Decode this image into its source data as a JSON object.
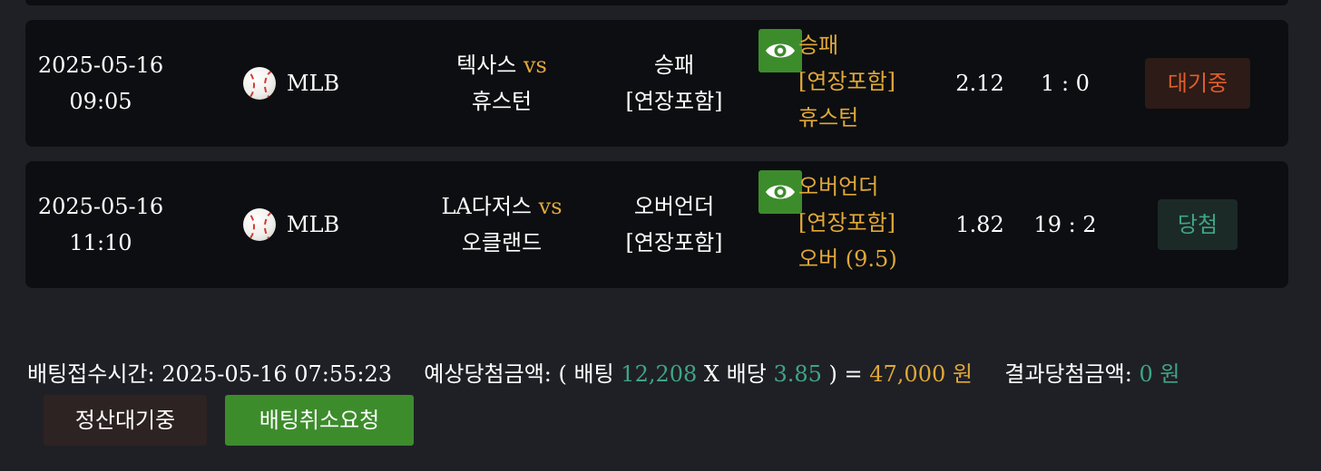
{
  "bets": [
    {
      "date": "2025-05-16",
      "time": "09:05",
      "league": "MLB",
      "league_icon": "baseball-icon",
      "home_team": "텍사스",
      "vs": "vs",
      "away_team": "휴스턴",
      "market_line1": "승패",
      "market_line2": "[연장포함]",
      "pick_line1": "승패",
      "pick_line2": "[연장포함]",
      "pick_line3": "휴스턴",
      "odds": "2.12",
      "score": "1 : 0",
      "status": "대기중",
      "status_color": "#e05d2b"
    },
    {
      "date": "2025-05-16",
      "time": "11:10",
      "league": "MLB",
      "league_icon": "baseball-icon",
      "home_team": "LA다저스",
      "vs": "vs",
      "away_team": "오클랜드",
      "market_line1": "오버언더",
      "market_line2": "[연장포함]",
      "pick_line1": "오버언더",
      "pick_line2": "[연장포함]",
      "pick_line3": "오버 (9.5)",
      "odds": "1.82",
      "score": "19 : 2",
      "status": "당첨",
      "status_color": "#3fa585"
    }
  ],
  "summary": {
    "bet_time_label": "배팅접수시간:",
    "bet_time": "2025-05-16 07:55:23",
    "expected_label": "예상당첨금액: ( 배팅",
    "bet_amount": "12,208",
    "x_label": "X 배당",
    "total_odds": "3.85",
    "equals": ") =",
    "expected_amount": "47,000 원",
    "result_label": "결과당첨금액:",
    "result_amount": "0 원"
  },
  "actions": {
    "settle_label": "정산대기중",
    "cancel_label": "배팅취소요청"
  },
  "colors": {
    "accent_gold": "#e0a838",
    "accent_green": "#3fa585",
    "button_green": "#3d8c2c"
  }
}
